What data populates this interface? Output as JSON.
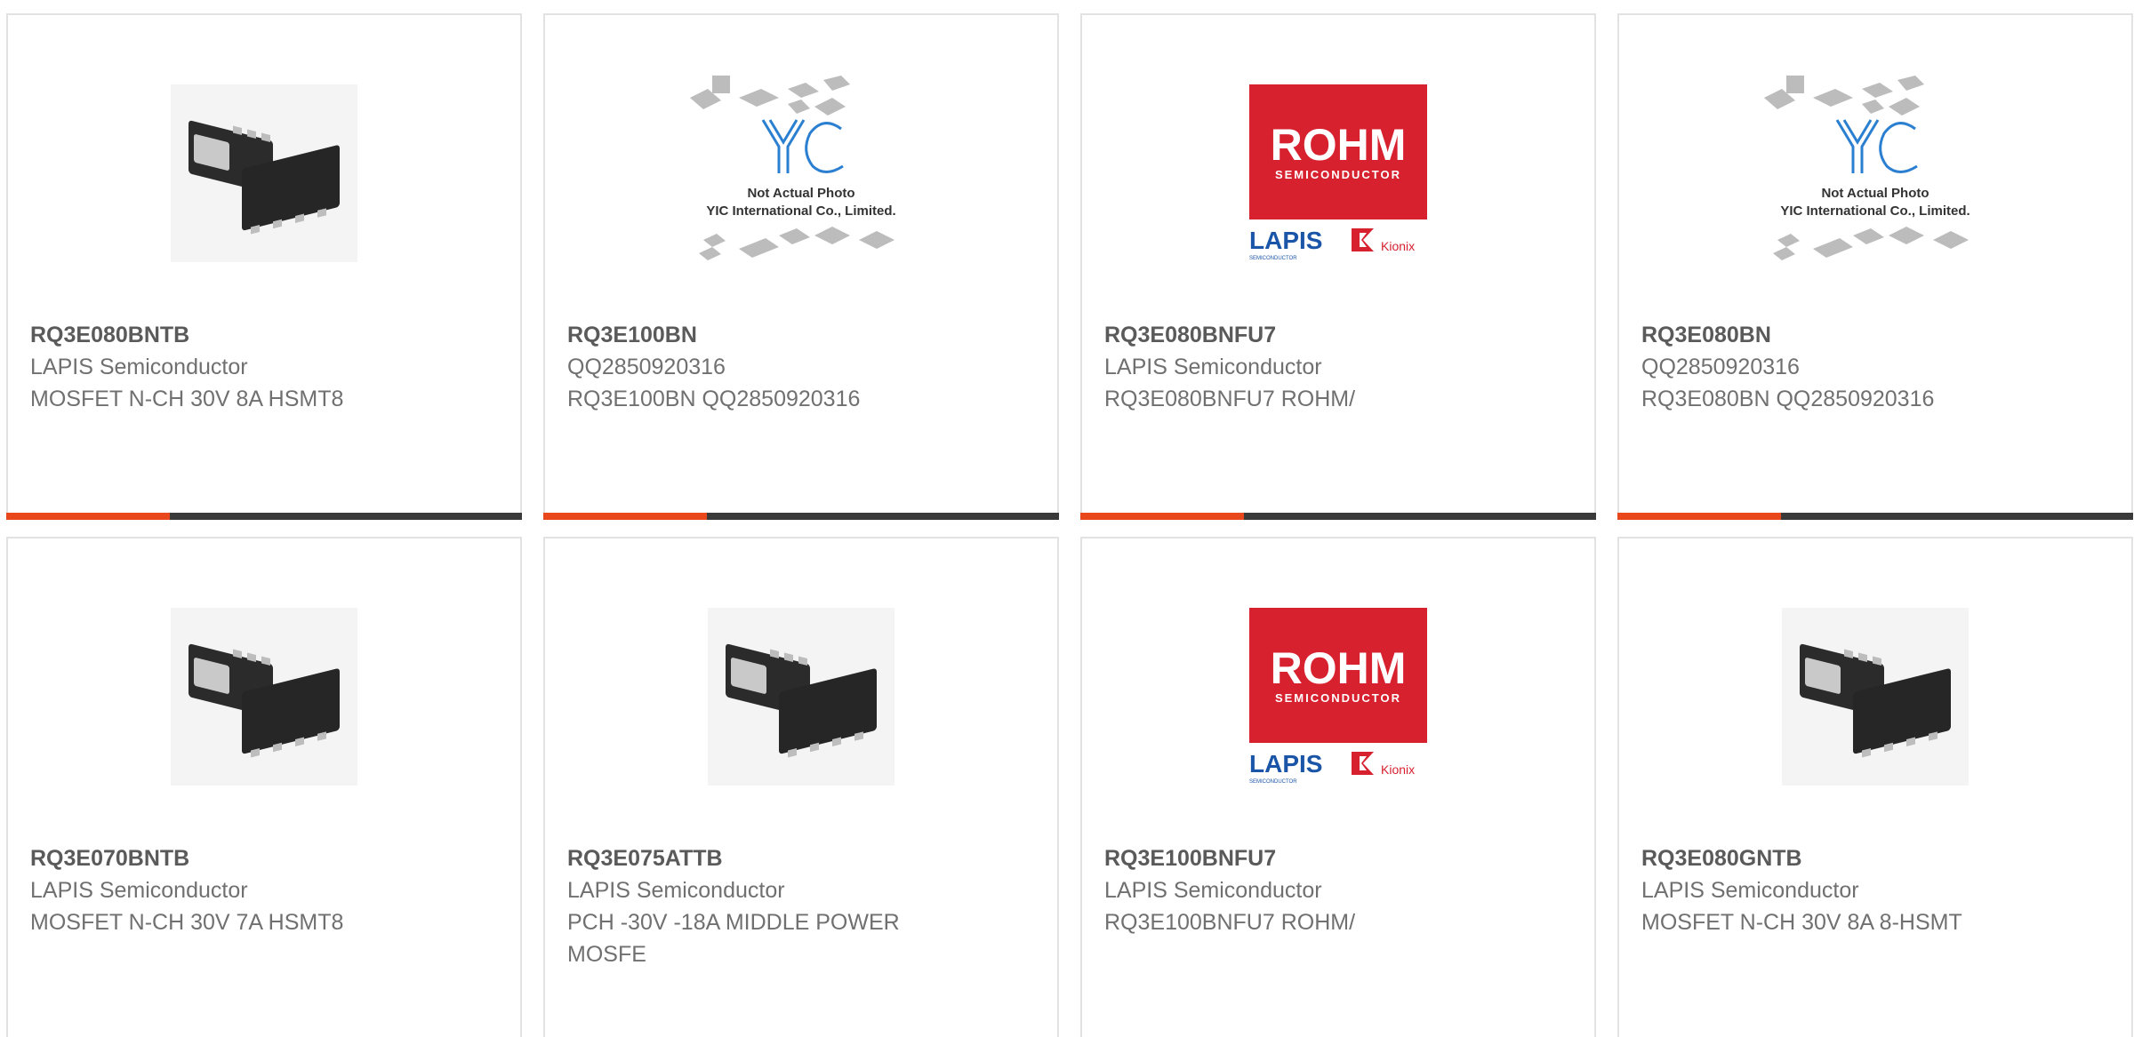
{
  "cards": [
    {
      "part": "RQ3E080BNTB",
      "line1": "LAPIS Semiconductor",
      "line2": "MOSFET N-CH 30V 8A HSMT8",
      "image": "chip-photo"
    },
    {
      "part": "RQ3E100BN",
      "line1": "QQ2850920316",
      "line2": "RQ3E100BN QQ2850920316",
      "image": "yic-placeholder",
      "image_text": [
        "Not Actual Photo",
        "YIC International Co., Limited."
      ]
    },
    {
      "part": "RQ3E080BNFU7",
      "line1": "LAPIS Semiconductor",
      "line2": "RQ3E080BNFU7 ROHM/",
      "image": "rohm-logo"
    },
    {
      "part": "RQ3E080BN",
      "line1": "QQ2850920316",
      "line2": "RQ3E080BN QQ2850920316",
      "image": "yic-placeholder",
      "image_text": [
        "Not Actual Photo",
        "YIC International Co., Limited."
      ]
    },
    {
      "part": "RQ3E070BNTB",
      "line1": "LAPIS Semiconductor",
      "line2": "MOSFET N-CH 30V 7A HSMT8",
      "image": "chip-photo"
    },
    {
      "part": "RQ3E075ATTB",
      "line1": "LAPIS Semiconductor",
      "line2": "PCH -30V -18A MIDDLE POWER",
      "line3": "MOSFE",
      "image": "chip-photo"
    },
    {
      "part": "RQ3E100BNFU7",
      "line1": "LAPIS Semiconductor",
      "line2": "RQ3E100BNFU7 ROHM/",
      "image": "rohm-logo"
    },
    {
      "part": "RQ3E080GNTB",
      "line1": "LAPIS Semiconductor",
      "line2": "MOSFET N-CH 30V 8A 8-HSMT",
      "image": "chip-photo"
    }
  ],
  "colors": {
    "accent": "#e8481c",
    "bar": "#3a3a3a",
    "rohm_red": "#d7212f",
    "lapis_blue": "#1b55a8",
    "yic_blue": "#2a7fd0"
  }
}
